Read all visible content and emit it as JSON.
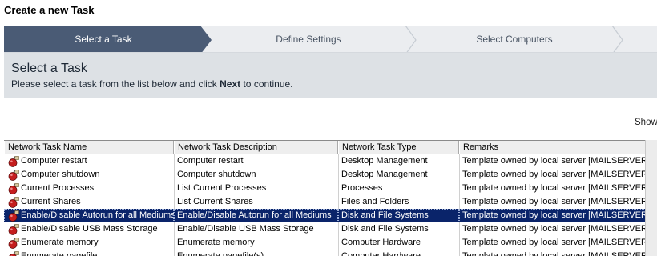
{
  "page": {
    "title": "Create a new Task"
  },
  "wizard": {
    "steps": [
      {
        "label": "Select a Task",
        "active": true
      },
      {
        "label": "Define Settings",
        "active": false
      },
      {
        "label": "Select Computers",
        "active": false
      }
    ]
  },
  "panel": {
    "heading": "Select a Task",
    "instruction_before": "Please select a task from the list below and click ",
    "instruction_bold": "Next",
    "instruction_after": " to continue."
  },
  "show_label": "Show",
  "table": {
    "columns": [
      "Network Task Name",
      "Network Task Description",
      "Network Task Type",
      "Remarks"
    ],
    "rows": [
      {
        "name": "Computer restart",
        "description": "Computer restart",
        "type": "Desktop Management",
        "remarks": "Template owned by local server [MAILSERVER]",
        "selected": false
      },
      {
        "name": "Computer shutdown",
        "description": "Computer shutdown",
        "type": "Desktop Management",
        "remarks": "Template owned by local server [MAILSERVER]",
        "selected": false
      },
      {
        "name": "Current Processes",
        "description": "List Current Processes",
        "type": "Processes",
        "remarks": "Template owned by local server [MAILSERVER]",
        "selected": false
      },
      {
        "name": "Current Shares",
        "description": "List Current Shares",
        "type": "Files and Folders",
        "remarks": "Template owned by local server [MAILSERVER]",
        "selected": false
      },
      {
        "name": "Enable/Disable Autorun for all Mediums",
        "description": "Enable/Disable Autorun for all Mediums",
        "type": "Disk and File Systems",
        "remarks": "Template owned by local server [MAILSERVER]",
        "selected": true
      },
      {
        "name": "Enable/Disable USB Mass Storage",
        "description": "Enable/Disable USB Mass Storage",
        "type": "Disk and File Systems",
        "remarks": "Template owned by local server [MAILSERVER]",
        "selected": false
      },
      {
        "name": "Enumerate memory",
        "description": "Enumerate memory",
        "type": "Computer Hardware",
        "remarks": "Template owned by local server [MAILSERVER]",
        "selected": false
      },
      {
        "name": "Enumerate pagefile",
        "description": "Enumerate pagefile(s)",
        "type": "Computer Hardware",
        "remarks": "Template owned by local server [MAILSERVER]",
        "selected": false
      }
    ]
  },
  "colors": {
    "wizard_active": "#4a5b75",
    "wizard_inactive": "#ebedf0",
    "panel_bg": "#dde1e5",
    "selection": "#0a246a"
  },
  "icons": {
    "task": "task-bomb-icon",
    "chevron": "chevron-right-icon"
  }
}
